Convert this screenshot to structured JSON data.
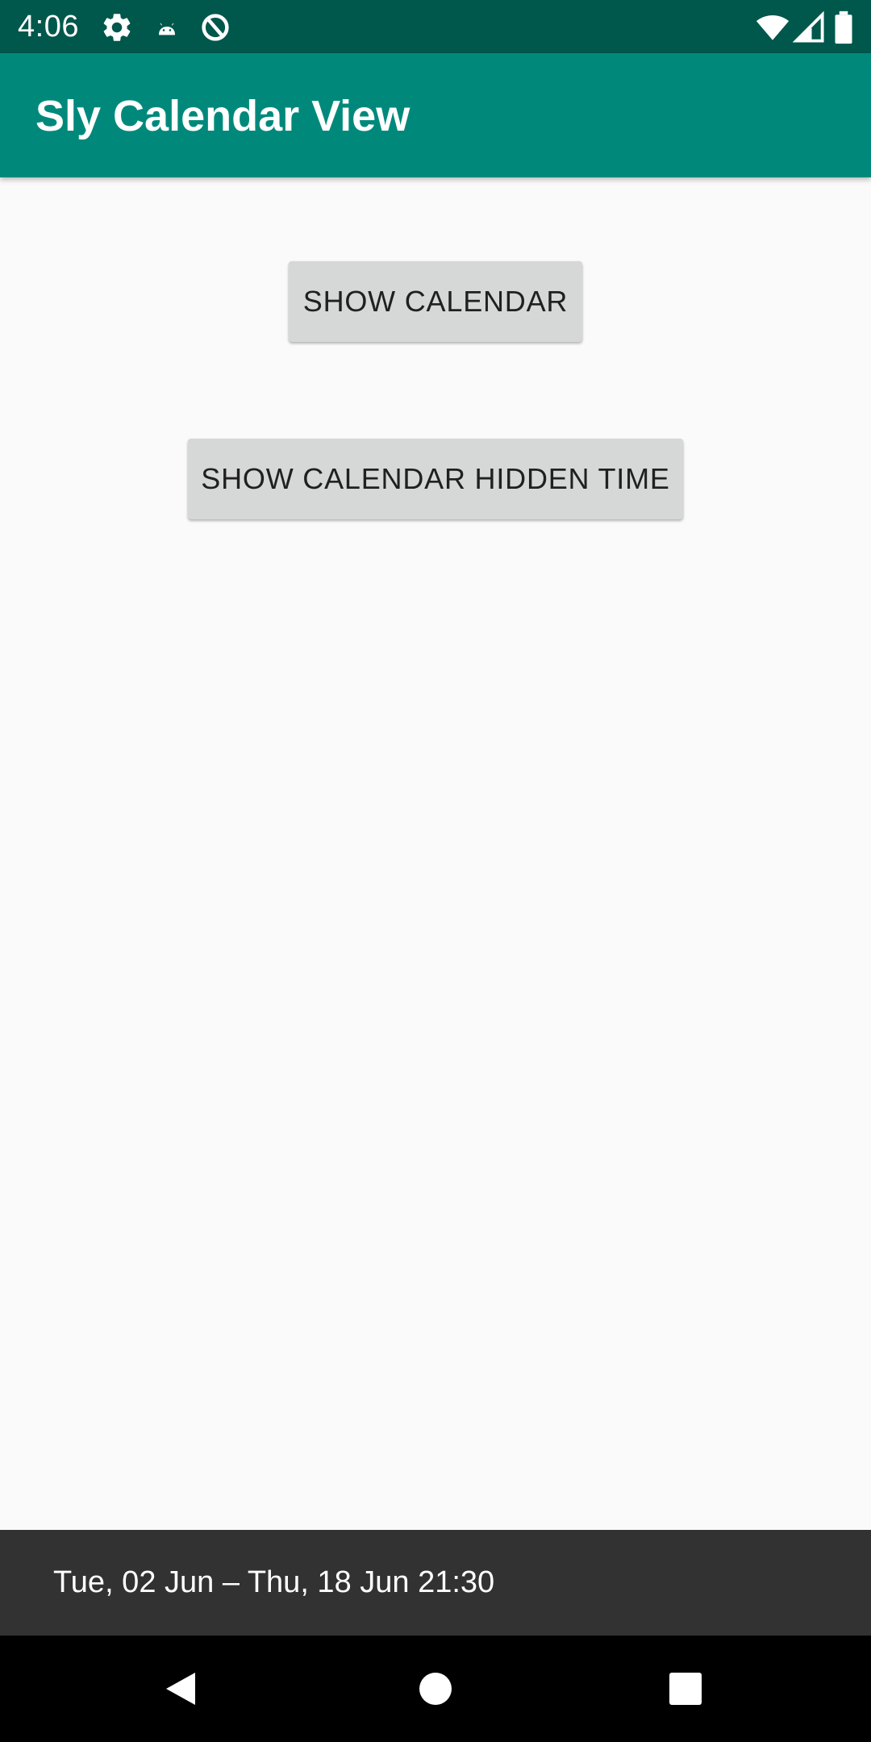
{
  "status_bar": {
    "time": "4:06",
    "background": "#00574B",
    "left_icons": [
      "settings-icon",
      "android-icon",
      "data-saver-icon"
    ],
    "right_icons": [
      "wifi-icon",
      "cellular-signal-icon",
      "battery-icon"
    ]
  },
  "app_bar": {
    "title": "Sly Calendar View",
    "background": "#00897B"
  },
  "main": {
    "buttons": [
      {
        "label": "SHOW CALENDAR"
      },
      {
        "label": "SHOW CALENDAR HIDDEN TIME"
      }
    ],
    "background": "#FAFAFA",
    "button_color": "#D6D7D7"
  },
  "snackbar": {
    "text": "Tue, 02 Jun – Thu, 18 Jun 21:30",
    "background": "#323232"
  },
  "nav_bar": {
    "icons": [
      "back-icon",
      "home-icon",
      "recents-icon"
    ],
    "background": "#000000"
  }
}
